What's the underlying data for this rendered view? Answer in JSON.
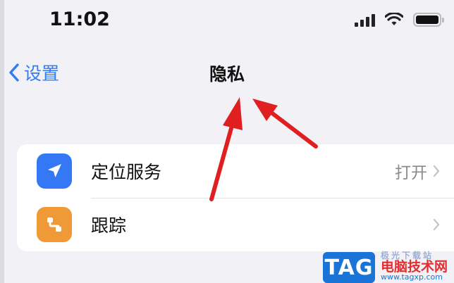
{
  "status_bar": {
    "time": "11:02"
  },
  "nav": {
    "back_label": "设置",
    "title": "隐私"
  },
  "settings": {
    "rows": [
      {
        "label": "定位服务",
        "value": "打开",
        "icon": "location-arrow-icon",
        "icon_color": "#3478f6"
      },
      {
        "label": "跟踪",
        "value": "",
        "icon": "tracking-icon",
        "icon_color": "#f09a37"
      }
    ]
  },
  "annotation": {
    "arrow_color": "#e02020"
  },
  "watermark": {
    "badge": "TAG",
    "top_text": "极光下载站",
    "site_name": "电脑技术网",
    "url": "www.tagxp.com"
  }
}
